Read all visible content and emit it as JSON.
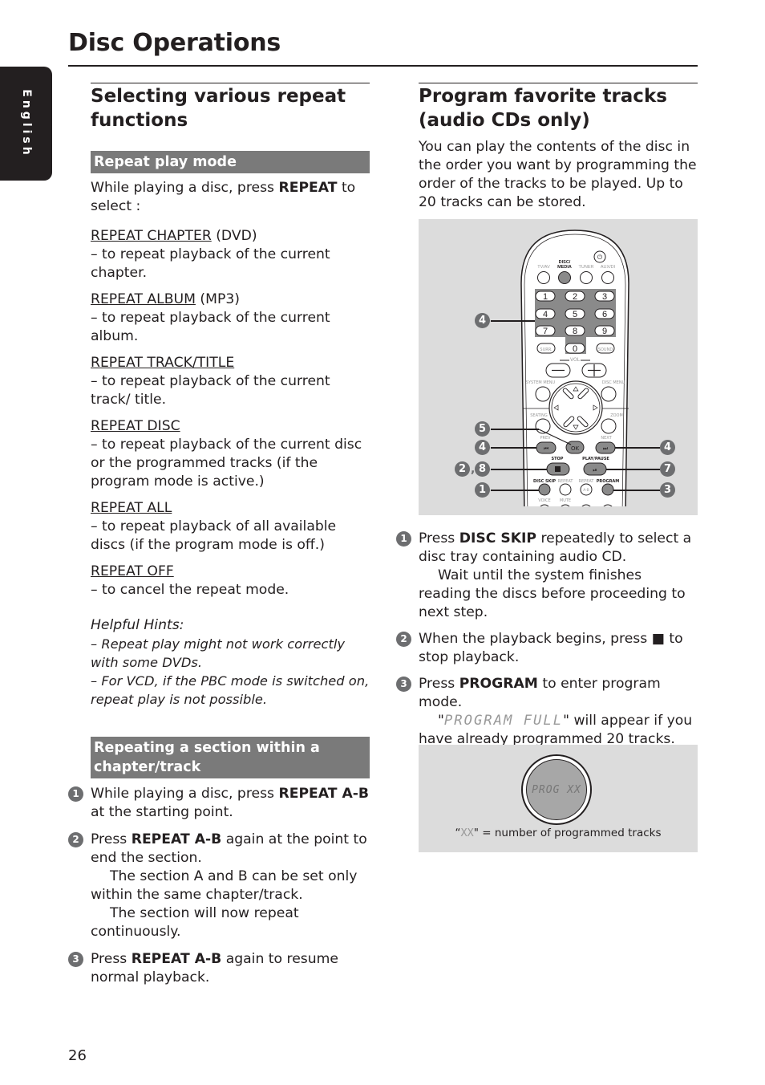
{
  "page": {
    "title": "Disc Operations",
    "language_tab": "English",
    "page_number": "26"
  },
  "left": {
    "heading": "Selecting various repeat functions",
    "repeat_play_mode": {
      "bar": "Repeat play mode",
      "intro_pre": "While playing a disc, press ",
      "intro_bold": "REPEAT",
      "intro_post": " to select :",
      "options": [
        {
          "name": "REPEAT CHAPTER",
          "suffix": " (DVD)",
          "desc": "–  to repeat playback of the current chapter."
        },
        {
          "name": "REPEAT ALBUM",
          "suffix": " (MP3)",
          "desc": "–  to repeat playback of the current album."
        },
        {
          "name": "REPEAT TRACK/TITLE",
          "suffix": "",
          "desc": "–  to repeat playback of the current track/ title."
        },
        {
          "name": "REPEAT DISC",
          "suffix": "",
          "desc": "–  to repeat playback of the current disc or the programmed tracks (if the program mode is active.)"
        },
        {
          "name": "REPEAT ALL",
          "suffix": "",
          "desc": "–  to repeat playback of all available discs (if the program mode is off.)"
        },
        {
          "name": "REPEAT OFF",
          "suffix": "",
          "desc": "–  to cancel the repeat mode."
        }
      ],
      "hints_title": "Helpful Hints:",
      "hints": [
        "–  Repeat play might not work correctly with some DVDs.",
        "–  For VCD, if the PBC mode is switched on, repeat play is not possible."
      ]
    },
    "repeat_section": {
      "bar": "Repeating a section within a chapter/track",
      "steps": [
        {
          "num": "1",
          "pre": "While playing a disc, press ",
          "bold": "REPEAT A-B",
          "post": " at the starting point.",
          "notes": []
        },
        {
          "num": "2",
          "pre": "Press ",
          "bold": "REPEAT A-B",
          "post": " again at the point to end the section.",
          "notes": [
            "The section A and B can be set only within the same chapter/track.",
            "The section will now repeat continuously."
          ]
        },
        {
          "num": "3",
          "pre": "Press ",
          "bold": "REPEAT A-B",
          "post": " again to resume normal playback.",
          "notes": []
        }
      ]
    }
  },
  "right": {
    "heading": "Program favorite tracks (audio CDs only)",
    "intro": "You can play the contents of the disc in the order you want by programming the order of the tracks to be played. Up to 20 tracks can be stored.",
    "remote": {
      "source_labels": [
        "TV/AV",
        "DISC/ MEDIA",
        "TUNER",
        "AUX/DI"
      ],
      "digits": [
        "1",
        "2",
        "3",
        "4",
        "5",
        "6",
        "7",
        "8",
        "9",
        "0"
      ],
      "surr": "SURR.",
      "sound": "SOUND",
      "vol": "VOL",
      "system_menu": "SYSTEM MENU",
      "disc_menu": "DISC MENU",
      "seating": "SEATING",
      "zoom": "ZOOM",
      "prev": "PREV",
      "next": "NEXT",
      "ok": "OK",
      "stop": "STOP",
      "play_pause": "PLAY/PAUSE",
      "disc_skip": "DISC SKIP",
      "repeat": "REPEAT",
      "repeat_ab": "REPEAT",
      "ab": "A-B",
      "program": "PROGRAM",
      "voice": "VOICE",
      "mute": "MUTE",
      "callouts_left": [
        "4",
        "5",
        "4",
        "2, 8",
        "1"
      ],
      "callouts_right": [
        "4",
        "7",
        "3"
      ]
    },
    "steps": [
      {
        "num": "1",
        "pre": "Press ",
        "bold": "DISC SKIP",
        "post": " repeatedly to select a disc tray containing audio CD.",
        "note": "Wait until the system finishes reading the discs before proceeding to next step."
      },
      {
        "num": "2",
        "pre": "When the playback begins, press ",
        "bold": "■",
        "post": " to stop playback.",
        "note": ""
      },
      {
        "num": "3",
        "pre": "Press ",
        "bold": "PROGRAM",
        "post": " to enter program mode.",
        "note_pre": "\"",
        "note_lcd": "PROGRAM FULL",
        "note_post": "\" will appear if you have already programmed 20 tracks."
      }
    ],
    "display_figure": {
      "lcd_text": "PROG XX",
      "caption_lcd": "XX",
      "caption_post": "\" = number of programmed tracks",
      "caption_pre": "“"
    }
  }
}
